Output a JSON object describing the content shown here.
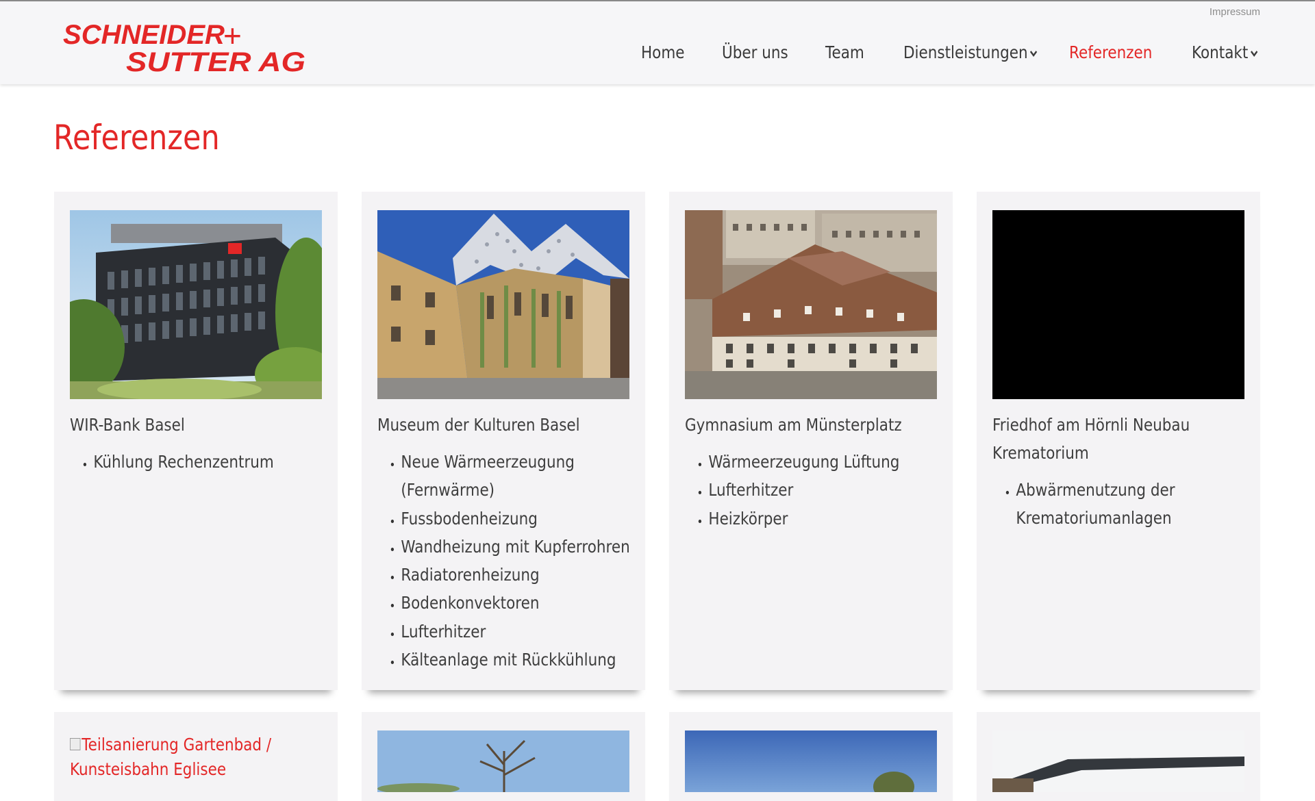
{
  "header": {
    "logo_line1": "SCHNEIDER",
    "logo_line2": "SUTTER AG",
    "logo_plus": "+",
    "impressum": "Impressum",
    "nav": [
      "Home",
      "Über uns",
      "Team",
      "Dienstleistungen",
      "Referenzen",
      "Kontakt"
    ],
    "active_nav": "Referenzen"
  },
  "page_title": "Referenzen",
  "cards": [
    {
      "title": "WIR-Bank Basel",
      "items": [
        "Kühlung Rechenzentrum"
      ]
    },
    {
      "title": "Museum der Kulturen Basel",
      "items": [
        "Neue Wärmeerzeugung (Fernwärme)",
        "Fussbodenheizung",
        "Wandheizung mit Kupferrohren",
        "Radiatorenheizung",
        "Bodenkonvektoren",
        "Lufterhitzer",
        "Kälteanlage mit Rückkühlung"
      ]
    },
    {
      "title": "Gymnasium am Münsterplatz",
      "items": [
        "Wärmeerzeugung Lüftung",
        "Lufterhitzer",
        "Heizkörper"
      ]
    },
    {
      "title": "Friedhof am Hörnli Neubau Krematorium",
      "items": [
        "Abwärmenutzung der Krematoriumanlagen"
      ]
    }
  ],
  "row2": {
    "broken_image_alt": "Teilsanierung Gartenbad / Kunsteisbahn Eglisee"
  },
  "colors": {
    "accent": "#e32727",
    "header_bg": "#f6f6f8",
    "card_bg": "#f4f3f5",
    "text": "#3e3e3e"
  }
}
